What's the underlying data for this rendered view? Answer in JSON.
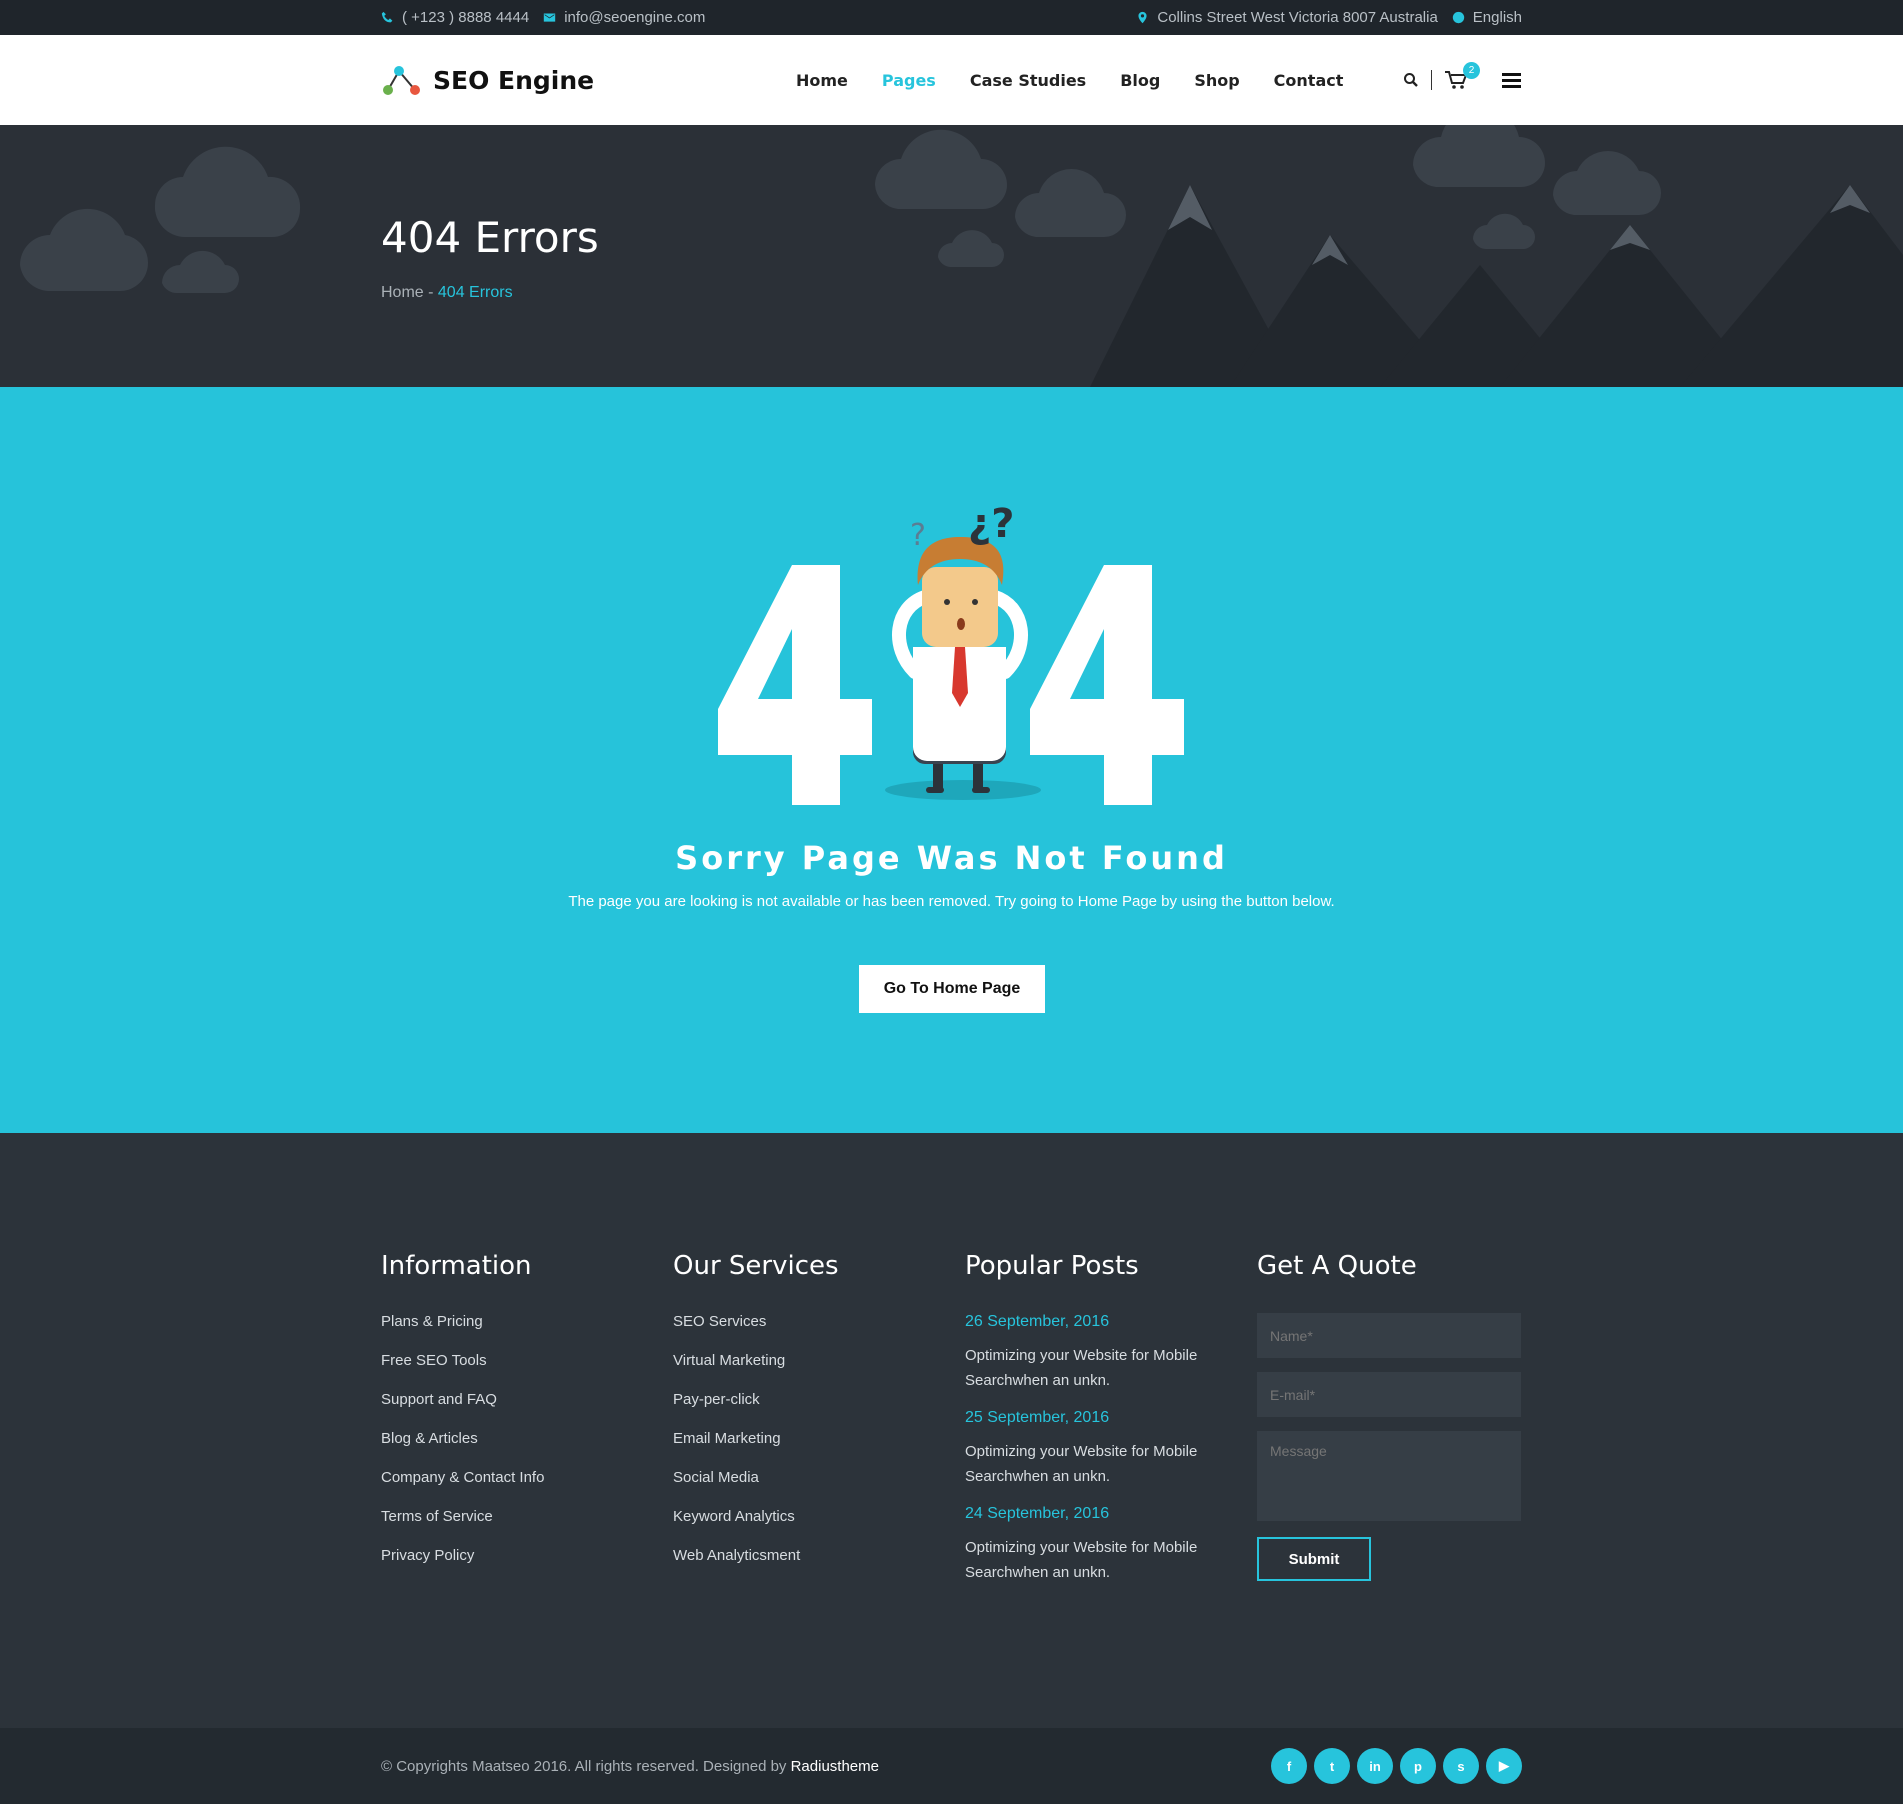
{
  "topbar": {
    "phone": "( +123 ) 8888 4444",
    "email": "info@seoengine.com",
    "address": "Collins Street West Victoria 8007 Australia",
    "language": "English"
  },
  "header": {
    "brand": "SEO Engine",
    "nav": [
      "Home",
      "Pages",
      "Case Studies",
      "Blog",
      "Shop",
      "Contact"
    ],
    "active_nav": "Pages",
    "cart_count": "2"
  },
  "banner": {
    "title": "404 Errors",
    "breadcrumb_home": "Home",
    "breadcrumb_sep": " - ",
    "breadcrumb_current": "404 Errors"
  },
  "error": {
    "heading": "Sorry Page Was Not Found",
    "message": "The page you are looking is not available or has been removed. Try going to Home Page by using the button below.",
    "button": "Go To Home Page"
  },
  "footer": {
    "information": {
      "title": "Information",
      "links": [
        "Plans & Pricing",
        "Free SEO Tools",
        "Support and FAQ",
        "Blog & Articles",
        "Company & Contact Info",
        "Terms of Service",
        "Privacy Policy"
      ]
    },
    "services": {
      "title": "Our Services",
      "links": [
        "SEO Services",
        "Virtual Marketing",
        "Pay-per-click",
        "Email Marketing",
        "Social Media",
        "Keyword Analytics",
        "Web Analyticsment"
      ]
    },
    "posts": {
      "title": "Popular Posts",
      "items": [
        {
          "date": "26 September, 2016",
          "title": "Optimizing your Website for Mobile Searchwhen an unkn."
        },
        {
          "date": "25 September, 2016",
          "title": "Optimizing your Website for Mobile Searchwhen an unkn."
        },
        {
          "date": "24 September, 2016",
          "title": "Optimizing your Website for Mobile Searchwhen an unkn."
        }
      ]
    },
    "quote": {
      "title": "Get A Quote",
      "name_placeholder": "Name*",
      "email_placeholder": "E-mail*",
      "message_placeholder": "Message",
      "submit": "Submit"
    }
  },
  "bottom": {
    "copyright": "© Copyrights Maatseo 2016. All rights reserved. Designed by ",
    "designer": "Radiustheme",
    "social": [
      "f",
      "t",
      "in",
      "p",
      "s",
      "▶"
    ]
  },
  "colors": {
    "accent": "#27c4dc",
    "dark": "#2c333a",
    "error_bg": "#26c3da"
  }
}
